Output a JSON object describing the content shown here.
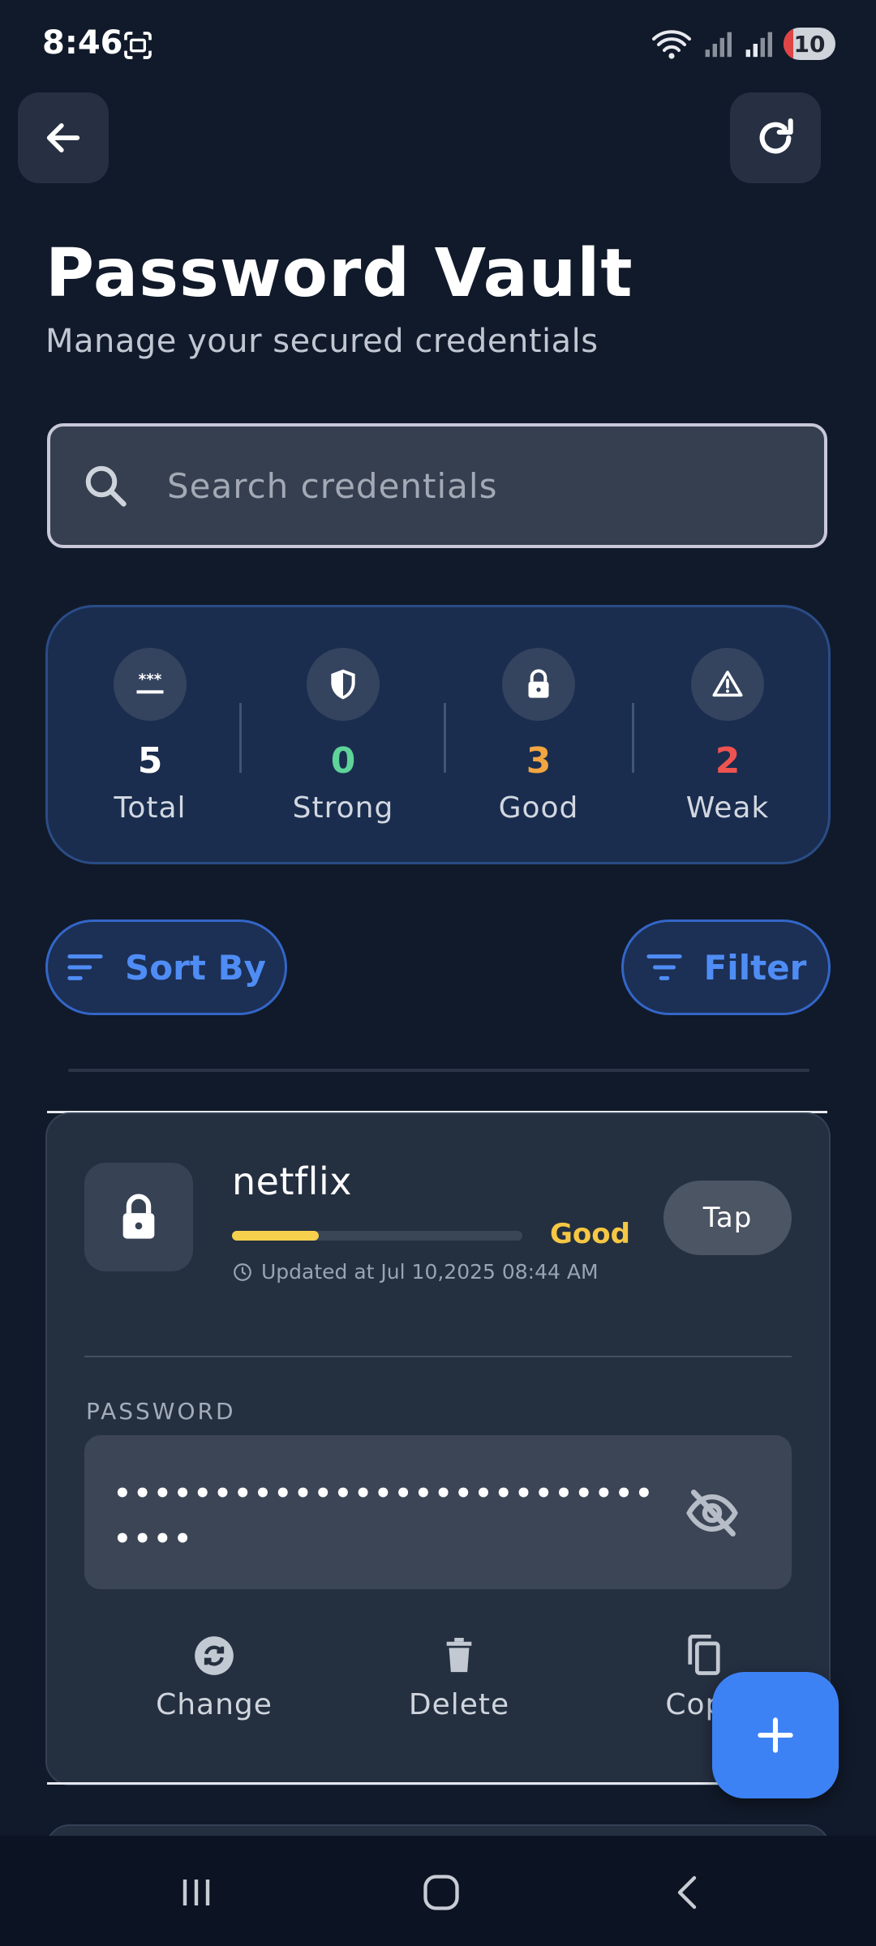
{
  "status_bar": {
    "time": "8:46",
    "battery": "10"
  },
  "header": {
    "title": "Password Vault",
    "subtitle": "Manage your secured credentials"
  },
  "search": {
    "placeholder": "Search credentials",
    "value": ""
  },
  "stats": {
    "total": {
      "value": "5",
      "label": "Total",
      "icon": "password-dots-icon"
    },
    "strong": {
      "value": "0",
      "label": "Strong",
      "icon": "shield-icon",
      "color": "#5fd39a"
    },
    "good": {
      "value": "3",
      "label": "Good",
      "icon": "lock-icon",
      "color": "#f2a541"
    },
    "weak": {
      "value": "2",
      "label": "Weak",
      "icon": "warning-icon",
      "color": "#ef5350"
    }
  },
  "controls": {
    "sort_label": "Sort By",
    "filter_label": "Filter"
  },
  "credential": {
    "name": "netflix",
    "strength_label": "Good",
    "strength_fraction": 0.3,
    "updated": "Updated at Jul 10,2025 08:44 AM",
    "tap_label": "Tap",
    "password_label": "PASSWORD",
    "password_masked": "•••••••••••••••••••••••••••••••",
    "actions": {
      "change": "Change",
      "delete": "Delete",
      "copy": "Copy"
    }
  },
  "colors": {
    "accent": "#3d82f5",
    "good": "#f6c744"
  }
}
